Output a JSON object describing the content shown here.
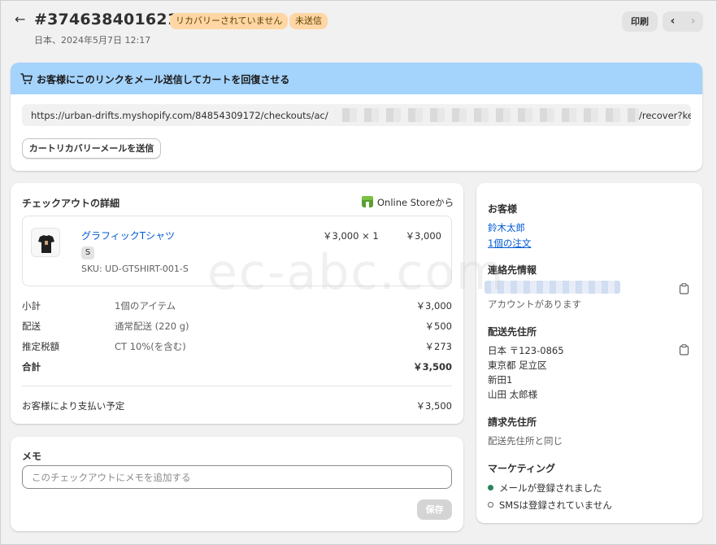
{
  "header": {
    "title": "#37463840162100",
    "badges": {
      "recovery": "リカバリーされていません",
      "unsent": "未送信"
    },
    "subtitle": "日本、2024年5月7日 12:17",
    "print_label": "印刷",
    "prev_icon": "chevron-left-icon",
    "next_icon": "chevron-right-icon"
  },
  "recovery": {
    "banner_text": "お客様にこのリンクをメール送信してカートを回復させる",
    "url_prefix": "https://urban-drifts.myshopify.com/84854309172/checkouts/ac/",
    "url_suffix": "/recover?ke",
    "send_button": "カートリカバリーメールを送信",
    "banner_color": "#a4d3fb"
  },
  "checkout": {
    "title": "チェックアウトの詳細",
    "store_label": "Online Storeから",
    "item": {
      "name": "グラフィックTシャツ",
      "variant": "S",
      "sku": "SKU: UD-GTSHIRT-001-S",
      "qty_price": "￥3,000 × 1",
      "line_total": "￥3,000"
    },
    "summary": [
      {
        "label": "小計",
        "detail": "1個のアイテム",
        "value": "￥3,000"
      },
      {
        "label": "配送",
        "detail": "通常配送 (220 g)",
        "value": "￥500"
      },
      {
        "label": "推定税額",
        "detail": "CT 10%(を含む)",
        "value": "￥273"
      },
      {
        "label": "合計",
        "detail": "",
        "value": "￥3,500"
      }
    ],
    "payment_label": "お客様により支払い予定",
    "payment_value": "￥3,500"
  },
  "memo": {
    "title": "メモ",
    "placeholder": "このチェックアウトにメモを追加する",
    "save_label": "保存"
  },
  "customer": {
    "title": "お客様",
    "name": "鈴木太郎",
    "orders": "1個の注文",
    "contact_title": "連絡先情報",
    "account_status": "アカウントがあります",
    "shipping_title": "配送先住所",
    "shipping_lines": [
      "日本 〒123-0865",
      "東京都 足立区",
      "新田1",
      "山田 太郎様"
    ],
    "billing_title": "請求先住所",
    "billing_text": "配送先住所と同じ",
    "marketing_title": "マーケティング",
    "marketing": [
      {
        "label": "メールが登録されました",
        "subscribed": true
      },
      {
        "label": "SMSは登録されていません",
        "subscribed": false
      }
    ]
  },
  "watermark": "ec-abc.com"
}
